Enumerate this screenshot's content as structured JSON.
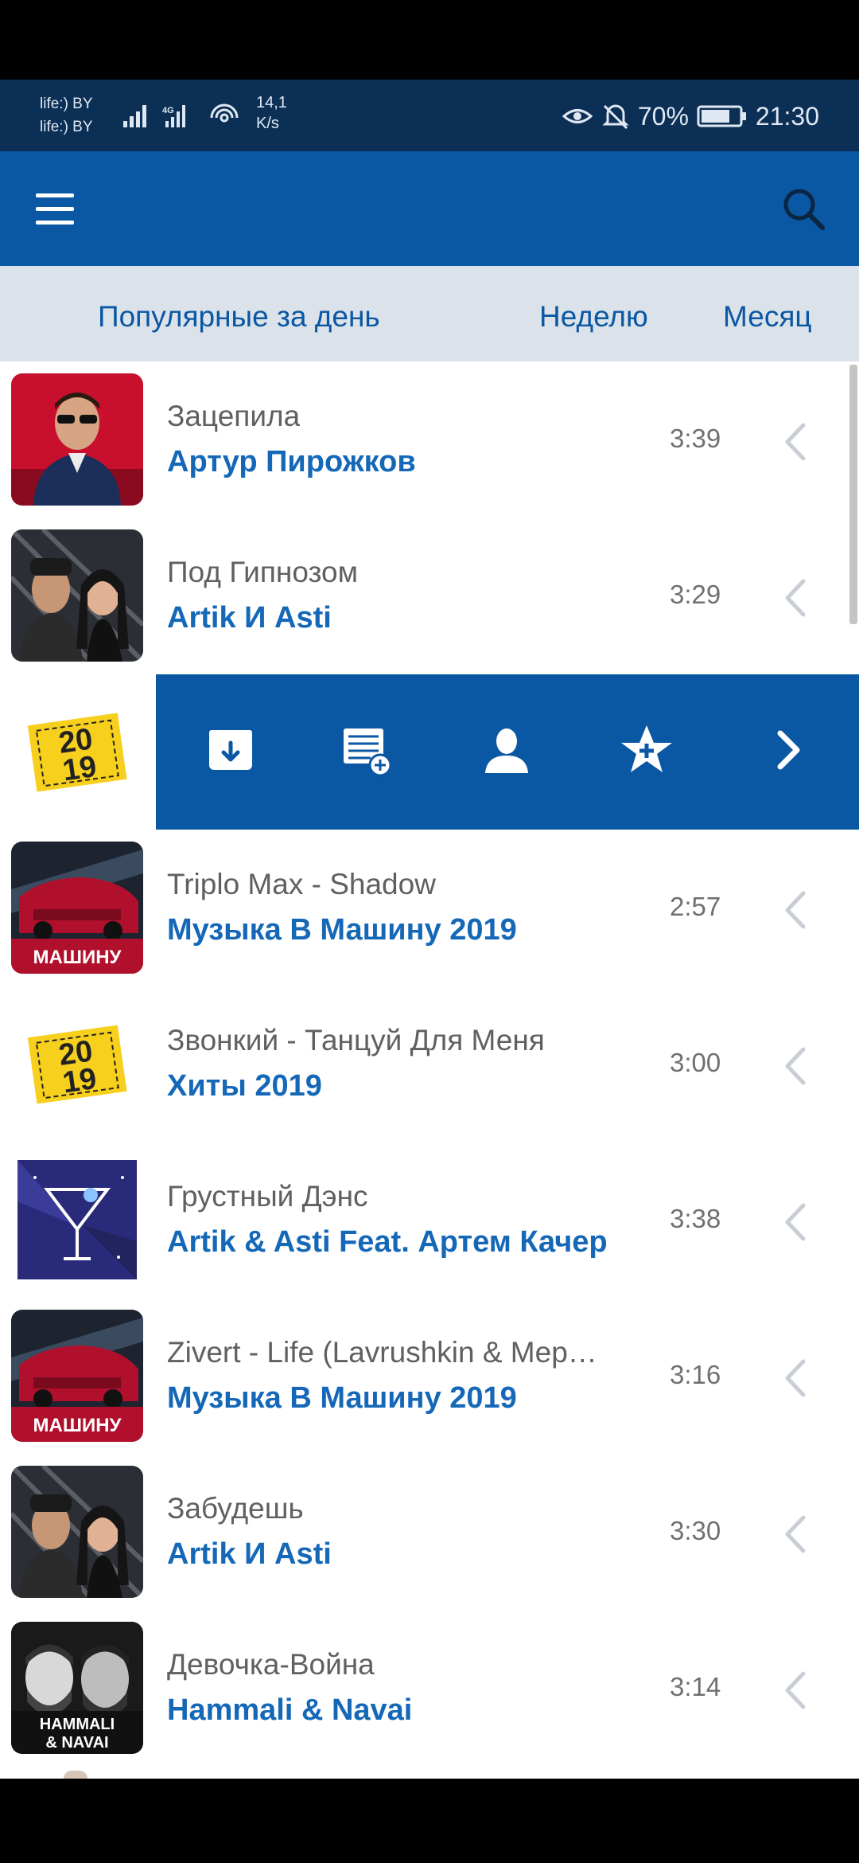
{
  "status_bar": {
    "carrier_1": "life:) BY",
    "carrier_2": "life:) BY",
    "speed_value": "14,1",
    "speed_unit": "K/s",
    "battery_percent": "70%",
    "time": "21:30",
    "icons": [
      "signal-bars-icon",
      "lte-icon",
      "wifi-icon",
      "eye-icon",
      "mute-icon",
      "battery-icon"
    ]
  },
  "app_bar": {
    "icons": [
      "menu-icon",
      "search-icon"
    ],
    "color": "#0a57a3"
  },
  "tabs": [
    "Популярные за день",
    "Неделю",
    "Месяц"
  ],
  "tracks": [
    {
      "title": "Зацепила",
      "artist": "Артур Пирожков",
      "duration": "3:39",
      "cover": "portrait-red"
    },
    {
      "title": "Под Гипнозом",
      "artist": "Artik И Asti",
      "duration": "3:29",
      "cover": "duo"
    },
    {
      "title": "",
      "artist": "",
      "duration": "",
      "cover": "2019-sticker",
      "actions_open": true
    },
    {
      "title": "Triplo Max - Shadow",
      "artist": "Музыка В Машину 2019",
      "duration": "2:57",
      "cover": "car"
    },
    {
      "title": "Звонкий - Танцуй Для Меня",
      "artist": "Хиты 2019",
      "duration": "3:00",
      "cover": "2019-sticker"
    },
    {
      "title": "Грустный Дэнс",
      "artist": "Artik & Asti Feat. Артем Качер",
      "duration": "3:38",
      "cover": "cocktail"
    },
    {
      "title": "Zivert - Life (Lavrushkin & Mep…",
      "artist": "Музыка В Машину 2019",
      "duration": "3:16",
      "cover": "car"
    },
    {
      "title": "Забудешь",
      "artist": "Artik И Asti",
      "duration": "3:30",
      "cover": "duo"
    },
    {
      "title": "Девочка-Война",
      "artist": "Hammali & Navai",
      "duration": "3:14",
      "cover": "bw"
    }
  ],
  "covers_text": {
    "car_label": "МАШИНУ",
    "sticker_line1": "20",
    "sticker_line2": "19",
    "bw_line1": "HAMMALI",
    "bw_line2": "& NAVAI"
  },
  "action_bar": {
    "icons": [
      "download-box-icon",
      "add-to-playlist-icon",
      "artist-person-icon",
      "favorite-star-icon",
      "chevron-right-icon"
    ]
  }
}
